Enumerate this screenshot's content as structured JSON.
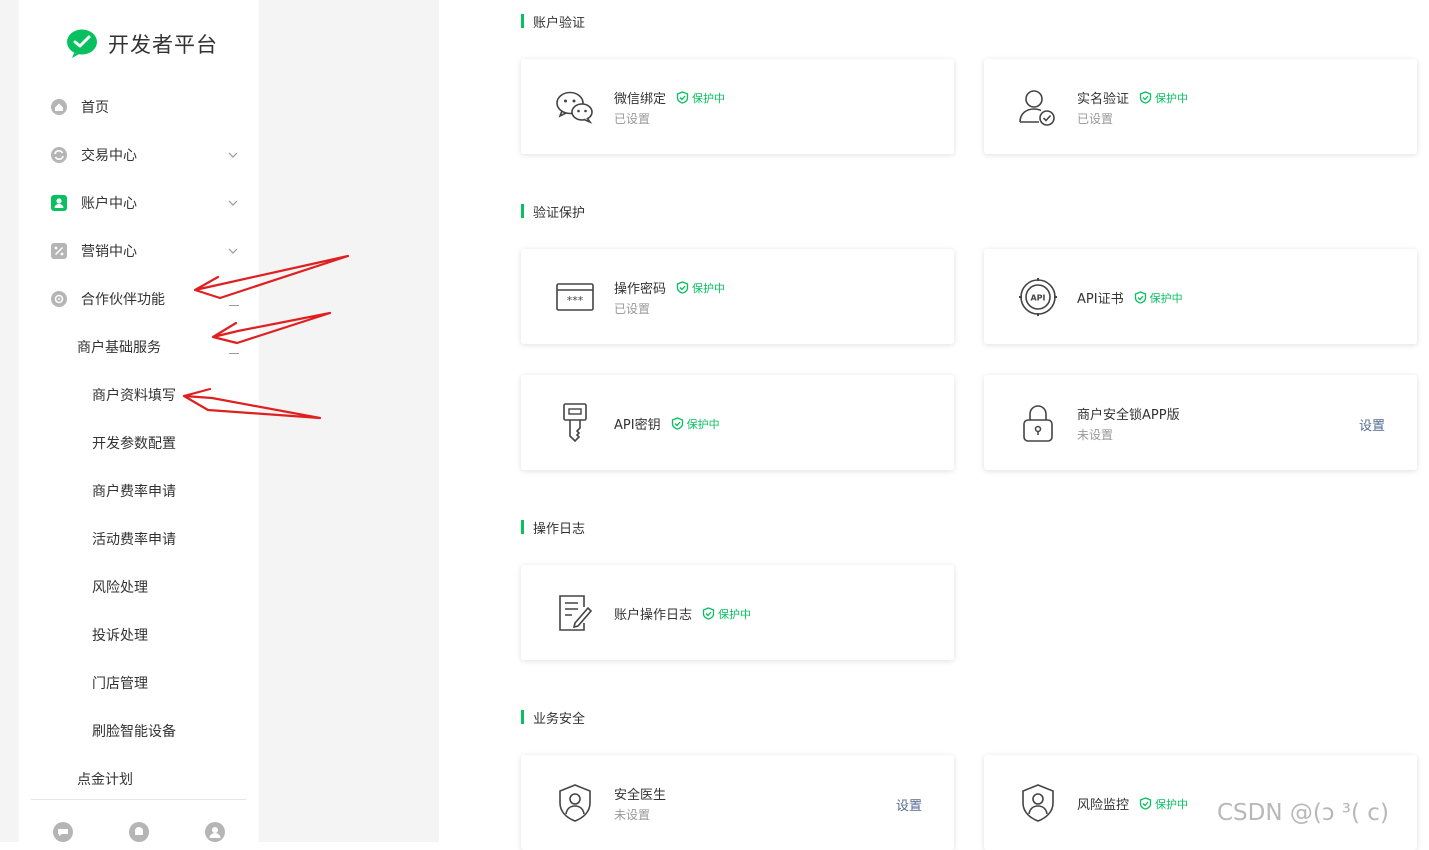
{
  "brand": {
    "name": "开发者平台",
    "logo_icon": "wechat-pay-logo-icon",
    "accent": "#07c160"
  },
  "nav": {
    "items": [
      {
        "label": "首页",
        "icon": "home-icon"
      },
      {
        "label": "交易中心",
        "icon": "exchange-icon"
      },
      {
        "label": "账户中心",
        "icon": "account-icon"
      },
      {
        "label": "营销中心",
        "icon": "marketing-icon"
      },
      {
        "label": "合作伙伴功能",
        "icon": "partner-icon"
      }
    ],
    "sub": {
      "label": "商户基础服务"
    },
    "subsub": [
      "商户资料填写",
      "开发参数配置",
      "商户费率申请",
      "活动费率申请",
      "风险处理",
      "投诉处理",
      "门店管理",
      "刷脸智能设备"
    ],
    "extra": {
      "label": "点金计划"
    },
    "footer_icons": [
      "message-icon",
      "bell-icon",
      "user-icon"
    ]
  },
  "sections": [
    {
      "title": "账户验证"
    },
    {
      "title": "验证保护"
    },
    {
      "title": "操作日志"
    },
    {
      "title": "业务安全"
    }
  ],
  "cards": [
    {
      "title": "微信绑定",
      "status": "保护中",
      "sub": "已设置",
      "icon": "wechat-chat-icon"
    },
    {
      "title": "实名验证",
      "status": "保护中",
      "sub": "已设置",
      "icon": "verified-user-icon"
    },
    {
      "title": "操作密码",
      "status": "保护中",
      "sub": "已设置",
      "icon": "password-icon"
    },
    {
      "title": "API证书",
      "status": "保护中",
      "icon": "api-certificate-icon"
    },
    {
      "title": "API密钥",
      "status": "保护中",
      "icon": "api-key-icon"
    },
    {
      "title": "商户安全锁APP版",
      "sub": "未设置",
      "action": "设置",
      "icon": "lock-icon"
    },
    {
      "title": "账户操作日志",
      "status": "保护中",
      "icon": "log-icon"
    },
    {
      "title": "安全医生",
      "sub": "未设置",
      "action": "设置",
      "icon": "shield-user-icon"
    },
    {
      "title": "风险监控",
      "status": "保护中",
      "icon": "shield-user-icon"
    }
  ],
  "watermark": "CSDN @(ↄ ³( c)",
  "annotation_color": "#e02020"
}
